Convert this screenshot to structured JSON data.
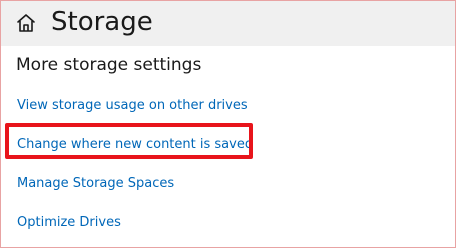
{
  "header": {
    "title": "Storage",
    "home_icon": "home-icon"
  },
  "section": {
    "heading": "More storage settings"
  },
  "links": [
    {
      "label": "View storage usage on other drives"
    },
    {
      "label": "Change where new content is saved",
      "highlighted": true
    },
    {
      "label": "Manage Storage Spaces"
    },
    {
      "label": "Optimize Drives"
    }
  ],
  "colors": {
    "header_background": "#f0f0f0",
    "link": "#0067b8",
    "highlight": "#e8141b",
    "text": "#1a1a1a"
  }
}
